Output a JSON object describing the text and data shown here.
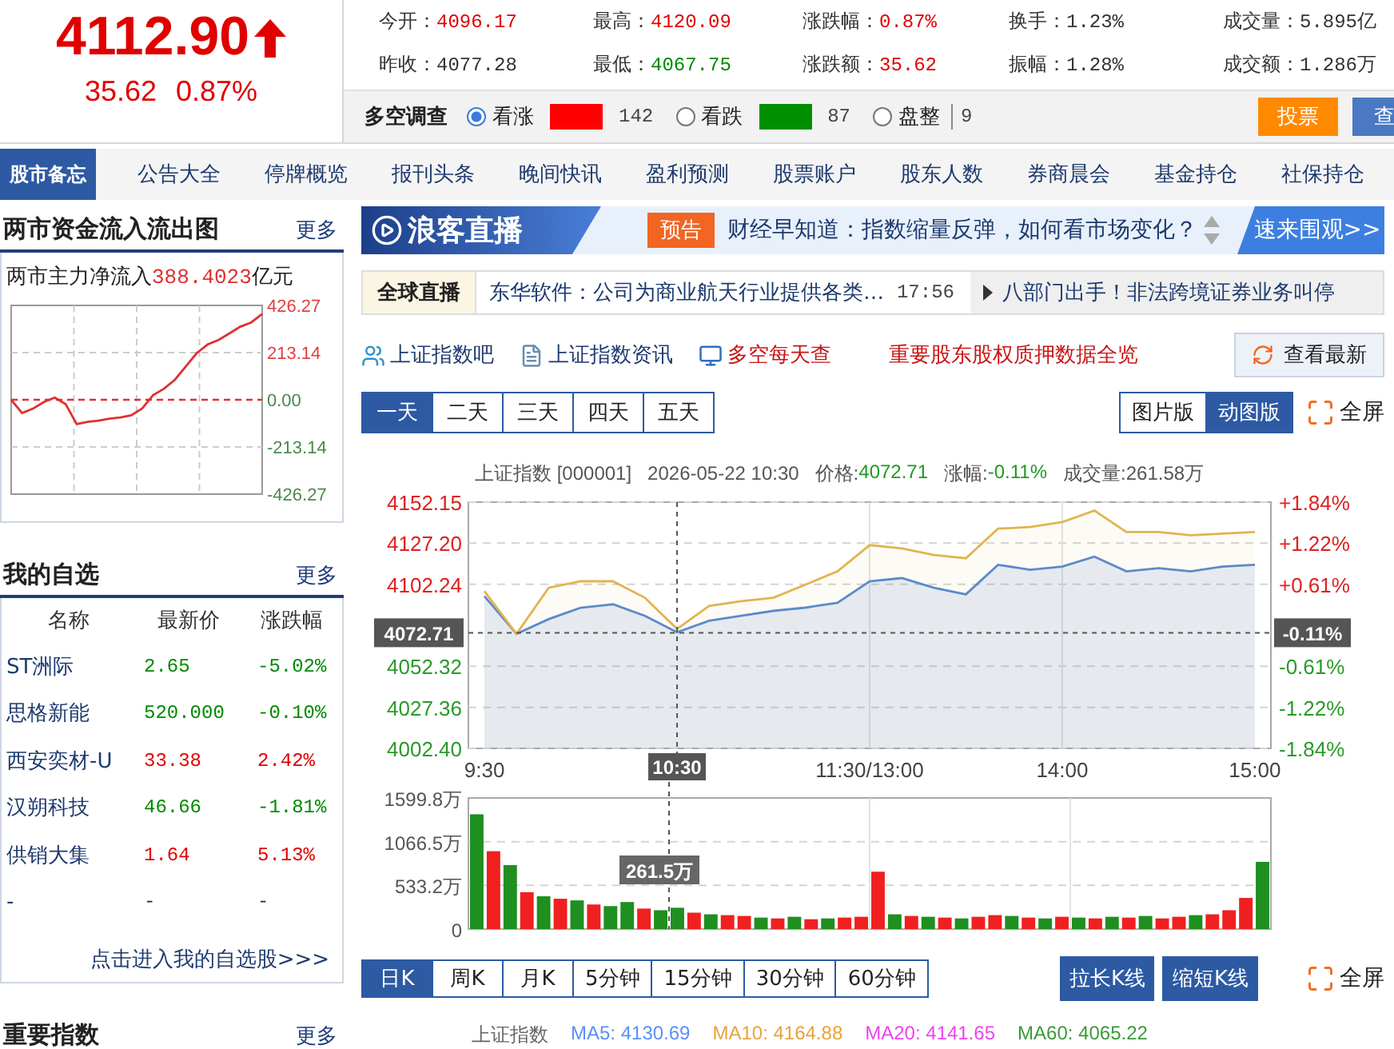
{
  "quote": {
    "price": "4112.90",
    "color": "#e00000",
    "change": "35.62",
    "change_pct": "0.87%"
  },
  "stats": [
    {
      "label": "今开：",
      "value": "4096.17",
      "color": "#e00000"
    },
    {
      "label": "最高：",
      "value": "4120.09",
      "color": "#e00000"
    },
    {
      "label": "涨跌幅：",
      "value": "0.87%",
      "color": "#e00000"
    },
    {
      "label": "换手：",
      "value": "1.23%",
      "color": "#333333"
    },
    {
      "label": "成交量：",
      "value": "5.895亿",
      "color": "#333333"
    },
    {
      "label": "昨收：",
      "value": "4077.28",
      "color": "#333333"
    },
    {
      "label": "最低：",
      "value": "4067.75",
      "color": "#008a00"
    },
    {
      "label": "涨跌额：",
      "value": "35.62",
      "color": "#e00000"
    },
    {
      "label": "振幅：",
      "value": "1.28%",
      "color": "#333333"
    },
    {
      "label": "成交额：",
      "value": "1.286万",
      "color": "#333333"
    }
  ],
  "survey": {
    "title": "多空调查",
    "options": [
      {
        "label": "看涨",
        "selected": true,
        "color": "#ff0000",
        "count": "142"
      },
      {
        "label": "看跌",
        "selected": false,
        "color": "#008f00",
        "count": "87"
      },
      {
        "label": "盘整",
        "selected": false,
        "count": "9"
      }
    ],
    "buttons": [
      {
        "label": "投票",
        "color": "#ff8a00"
      },
      {
        "label": "查",
        "color": "#4a78c2"
      }
    ]
  },
  "nav": {
    "title": "股市备忘",
    "items": [
      "公告大全",
      "停牌概览",
      "报刊头条",
      "晚间快讯",
      "盈利预测",
      "股票账户",
      "股东人数",
      "券商晨会",
      "基金持仓",
      "社保持仓"
    ]
  },
  "fund_flow": {
    "title": "两市资金流入流出图",
    "more": "更多",
    "label": "两市主力净流入",
    "value": "388.4023",
    "unit": "亿元",
    "chart_data": {
      "type": "line",
      "categories": [
        null,
        null,
        null,
        null,
        null,
        null,
        null,
        null,
        null,
        null,
        null,
        null,
        null,
        null,
        null,
        null,
        null,
        null,
        null,
        null,
        null,
        null,
        null,
        null
      ],
      "ylim": [
        -426.27,
        426.27
      ],
      "yticks": [
        {
          "value": 426.27,
          "label": "426.27"
        },
        {
          "value": 213.14,
          "label": "213.14"
        },
        {
          "value": 0,
          "label": "0.00"
        },
        {
          "value": -213.14,
          "label": "-213.14"
        },
        {
          "value": -426.27,
          "label": "-426.27"
        }
      ],
      "grid": true,
      "ref_lines": [
        {
          "axis": "y",
          "value": 0
        }
      ],
      "series": [
        {
          "color": "#e03030",
          "values": [
            0,
            -60,
            -40,
            -10,
            10,
            -20,
            -110,
            -100,
            -95,
            -85,
            -80,
            -70,
            -40,
            20,
            50,
            90,
            150,
            210,
            250,
            270,
            300,
            330,
            350,
            388
          ]
        }
      ]
    }
  },
  "watchlist": {
    "title": "我的自选",
    "more": "更多",
    "columns": [
      "名称",
      "最新价",
      "涨跌幅"
    ],
    "rows": [
      {
        "name": "ST洲际",
        "price": "2.65",
        "change": "-5.02%",
        "color": "#008a00"
      },
      {
        "name": "思格新能",
        "price": "520.000",
        "change": "-0.10%",
        "color": "#008a00"
      },
      {
        "name": "西安奕材-U",
        "price": "33.38",
        "change": "2.42%",
        "color": "#e00000"
      },
      {
        "name": "汉朔科技",
        "price": "46.66",
        "change": "-1.81%",
        "color": "#008a00"
      },
      {
        "name": "供销大集",
        "price": "1.64",
        "change": "5.13%",
        "color": "#e00000"
      },
      {
        "name": "-",
        "price": "-",
        "change": "-",
        "color": "#333333"
      }
    ],
    "link": "点击进入我的自选股>>>"
  },
  "indices_section": {
    "title": "重要指数",
    "more": "更多"
  },
  "banner": {
    "logo": "浪客直播",
    "badge": "预告",
    "headline": "财经早知道：指数缩量反弹，如何看市场变化？",
    "action": "速来围观>>"
  },
  "ticker": {
    "label": "全球直播",
    "headline": "东华软件：公司为商业航天行业提供各类…",
    "time": "17:56",
    "side_headline": "八部门出手！非法跨境证券业务叫停"
  },
  "links": [
    {
      "label": "上证指数吧",
      "kind": "forum",
      "highlighted": false
    },
    {
      "label": "上证指数资讯",
      "kind": "news",
      "highlighted": false
    },
    {
      "label": "多空每天查",
      "kind": "monitor",
      "highlighted": true
    },
    {
      "label": "重要股东股权质押数据全览",
      "kind": "plain",
      "highlighted": true
    }
  ],
  "refresh_button": "查看最新",
  "range_tabs": [
    {
      "label": "一天",
      "selected": true
    },
    {
      "label": "二天",
      "selected": false
    },
    {
      "label": "三天",
      "selected": false
    },
    {
      "label": "四天",
      "selected": false
    },
    {
      "label": "五天",
      "selected": false
    }
  ],
  "view_toggle": [
    {
      "label": "图片版",
      "selected": false
    },
    {
      "label": "动图版",
      "selected": true
    }
  ],
  "fullscreen": "全屏",
  "intraday": {
    "name": "上证指数 [000001]",
    "time": "2026-05-22 10:30",
    "fields": [
      {
        "label": "价格:",
        "value": "4072.71",
        "color": "#1f9a1f"
      },
      {
        "label": "涨幅:",
        "value": "-0.11%",
        "color": "#1f9a1f"
      },
      {
        "label": "成交量:",
        "value": "261.58万",
        "color": "#555555"
      }
    ],
    "right_axis": [
      {
        "label": "+1.84%",
        "color": "#e02020"
      },
      {
        "label": "+1.22%",
        "color": "#e02020"
      },
      {
        "label": "+0.61%",
        "color": "#e02020"
      },
      {
        "label": "-0.61%",
        "color": "#2a9a2a"
      },
      {
        "label": "-1.22%",
        "color": "#2a9a2a"
      },
      {
        "label": "-1.84%",
        "color": "#2a9a2a"
      }
    ],
    "crosshair_change": "-0.11%",
    "chart_data": {
      "type": "area",
      "grid": true,
      "categories": [
        "9:30",
        null,
        null,
        null,
        null,
        null,
        "10:30",
        null,
        null,
        null,
        null,
        null,
        "11:30/13:00",
        null,
        null,
        null,
        null,
        null,
        "14:00",
        null,
        null,
        null,
        null,
        null,
        "15:00"
      ],
      "ylim": [
        4002.4,
        4152.15
      ],
      "yticks": [
        {
          "value": 4152.15,
          "label": "4152.15"
        },
        {
          "value": 4127.2,
          "label": "4127.20"
        },
        {
          "value": 4102.24,
          "label": "4102.24"
        },
        {
          "value": 4052.32,
          "label": "4052.32"
        },
        {
          "value": 4027.36,
          "label": "4027.36"
        },
        {
          "value": 4002.4,
          "label": "4002.40"
        }
      ],
      "ref_lines": [
        {
          "axis": "y",
          "value": 4072.71,
          "label": "4072.71"
        }
      ],
      "series": [
        {
          "color": "#5b8ac8",
          "values": [
            4095,
            4072,
            4081,
            4088,
            4090,
            4083,
            4073,
            4080,
            4083,
            4086,
            4088,
            4091,
            4104,
            4106,
            4100,
            4096,
            4114,
            4111,
            4113,
            4119,
            4110,
            4112,
            4110,
            4113,
            4114
          ]
        },
        {
          "color": "#e0b450",
          "values": [
            4098,
            4072,
            4100,
            4104,
            4104,
            4094,
            4075,
            4089,
            4092,
            4094,
            4102,
            4110,
            4126,
            4124,
            4120,
            4118,
            4136,
            4137,
            4140,
            4147,
            4134,
            4134,
            4132,
            4133,
            4134
          ]
        }
      ]
    }
  },
  "volume": {
    "chart_data": {
      "type": "bar",
      "grid": true,
      "categories": [
        null,
        null,
        null,
        null,
        null,
        null,
        null,
        null,
        null,
        null,
        null,
        null,
        null,
        null,
        null,
        null,
        null,
        null,
        null,
        null,
        null,
        null,
        null,
        null,
        null,
        null,
        null,
        null,
        null,
        null,
        null,
        null,
        null,
        null,
        null,
        null,
        null,
        null,
        null,
        null,
        null,
        null,
        null,
        null,
        null,
        null,
        null,
        null
      ],
      "ylim": [
        0,
        1599.8
      ],
      "yticks": [
        {
          "value": 0,
          "label": "0"
        },
        {
          "value": 533.2,
          "label": "533.2万"
        },
        {
          "value": 1066.5,
          "label": "1066.5万"
        },
        {
          "value": 1599.8,
          "label": "1599.8万"
        }
      ],
      "series": [
        {
          "color": "#f02020",
          "values": [
            null,
            950,
            null,
            450,
            null,
            370,
            null,
            300,
            null,
            null,
            250,
            null,
            null,
            200,
            null,
            170,
            160,
            null,
            130,
            null,
            120,
            null,
            140,
            150,
            700,
            null,
            160,
            null,
            140,
            null,
            150,
            170,
            null,
            140,
            null,
            150,
            null,
            130,
            null,
            140,
            null,
            130,
            150,
            null,
            180,
            230,
            380,
            null
          ]
        },
        {
          "color": "#1f8f1f",
          "values": [
            1400,
            null,
            780,
            null,
            400,
            null,
            350,
            null,
            280,
            330,
            null,
            230,
            260,
            null,
            180,
            null,
            null,
            140,
            null,
            150,
            null,
            130,
            null,
            null,
            null,
            180,
            null,
            150,
            null,
            130,
            null,
            null,
            160,
            null,
            130,
            null,
            140,
            null,
            150,
            null,
            160,
            null,
            null,
            170,
            null,
            null,
            null,
            820
          ]
        }
      ],
      "annotations": [
        "261.5万"
      ]
    }
  },
  "kline_tabs": [
    {
      "label": "日K",
      "selected": true
    },
    {
      "label": "周K",
      "selected": false
    },
    {
      "label": "月K",
      "selected": false
    },
    {
      "label": "5分钟",
      "selected": false
    },
    {
      "label": "15分钟",
      "selected": false
    },
    {
      "label": "30分钟",
      "selected": false
    },
    {
      "label": "60分钟",
      "selected": false
    }
  ],
  "kline_buttons": [
    "拉长K线",
    "缩短K线"
  ],
  "kline_fullscreen": "全屏",
  "ma_row": {
    "name": "上证指数",
    "items": [
      {
        "label": "MA5: 4130.69",
        "color": "#5b8ff9"
      },
      {
        "label": "MA10: 4164.88",
        "color": "#e8a33a"
      },
      {
        "label": "MA20: 4141.65",
        "color": "#ee44ee"
      },
      {
        "label": "MA60: 4065.22",
        "color": "#3a9a3a"
      }
    ]
  }
}
